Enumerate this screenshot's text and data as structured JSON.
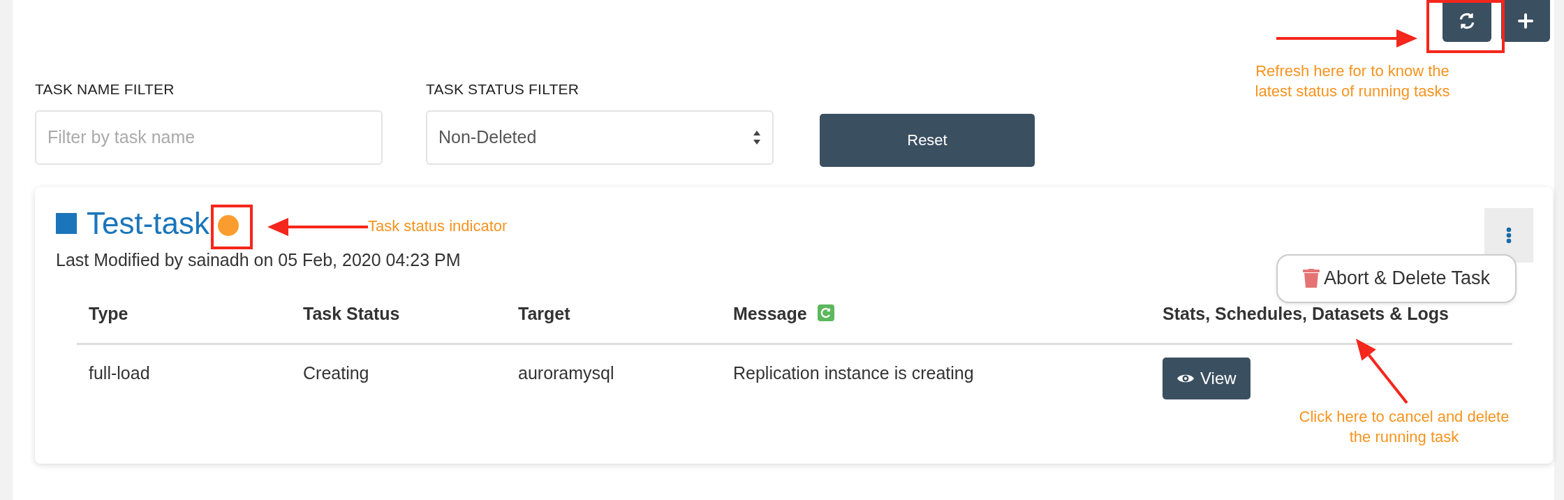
{
  "toolbar": {
    "buttons": [
      {
        "kind": "refresh"
      },
      {
        "kind": "add"
      }
    ]
  },
  "filters": [
    {
      "kind": "text",
      "label": "TASK NAME FILTER",
      "placeholder": "Filter by task name"
    },
    {
      "kind": "select",
      "label": "TASK STATUS FILTER",
      "value": "Non-Deleted"
    }
  ],
  "reset_button": "Reset",
  "task": {
    "name": "Test-task",
    "color": "#fb9d2e",
    "modified": "Last Modified by sainadh on 05 Feb, 2020 04:23 PM",
    "menu": {
      "expanded": true,
      "items": [
        {
          "label": "Abort & Delete Task"
        }
      ]
    },
    "table": {
      "columns": [
        {
          "label": "Type",
          "has_icon": false
        },
        {
          "label": "Task Status",
          "has_icon": false
        },
        {
          "label": "Target",
          "has_icon": false
        },
        {
          "label": "Message",
          "has_icon": true
        },
        {
          "label": "Stats, Schedules, Datasets & Logs",
          "has_icon": false
        }
      ],
      "rows": [
        [
          {
            "kind": "text",
            "text": "full-load"
          },
          {
            "kind": "text",
            "text": "Creating"
          },
          {
            "kind": "text",
            "text": "auroramysql"
          },
          {
            "kind": "text",
            "text": "Replication instance is creating"
          },
          {
            "kind": "button",
            "text": "View"
          }
        ]
      ]
    }
  },
  "annotations": [
    {
      "text": "Refresh here for to know the latest status of running tasks"
    },
    {
      "text": "Task status indicator"
    },
    {
      "text": "Click here to cancel and delete the running task"
    }
  ]
}
